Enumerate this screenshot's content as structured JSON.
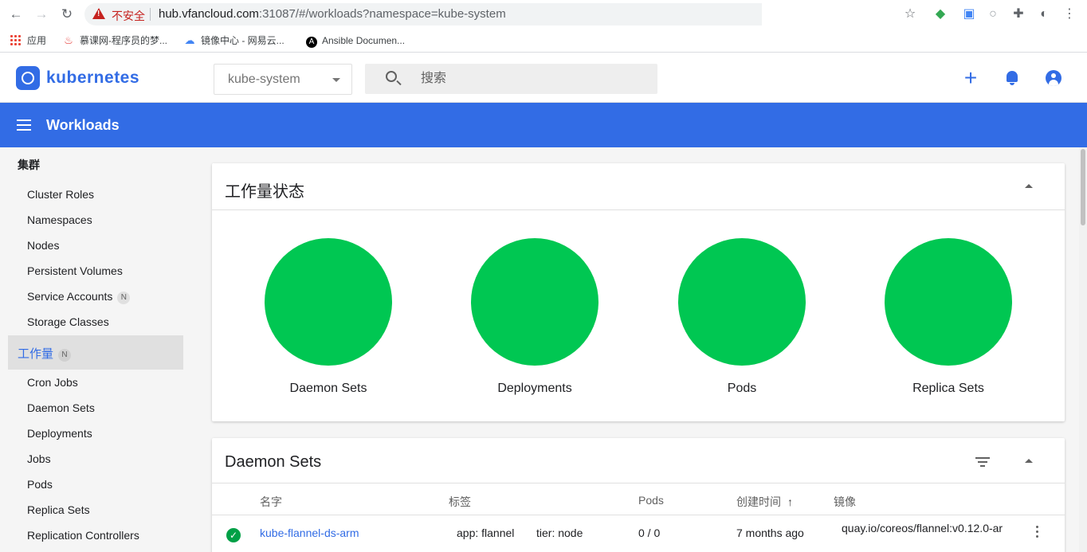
{
  "browser": {
    "security_label": "不安全",
    "url_host": "hub.vfancloud.com",
    "url_rest": ":31087/#/workloads?namespace=kube-system"
  },
  "bookmarks": [
    {
      "label": "应用"
    },
    {
      "label": "慕课网-程序员的梦..."
    },
    {
      "label": "镜像中心 - 网易云..."
    },
    {
      "label": "Ansible Documen..."
    }
  ],
  "header": {
    "brand": "kubernetes",
    "namespace": "kube-system",
    "search_placeholder": "搜索"
  },
  "toolbar": {
    "title": "Workloads"
  },
  "sidebar": {
    "cluster_header": "集群",
    "cluster_items": [
      {
        "label": "Cluster Roles"
      },
      {
        "label": "Namespaces"
      },
      {
        "label": "Nodes"
      },
      {
        "label": "Persistent Volumes"
      },
      {
        "label": "Service Accounts",
        "badge": "N"
      },
      {
        "label": "Storage Classes"
      }
    ],
    "active": {
      "label": "工作量",
      "badge": "N"
    },
    "workload_items": [
      {
        "label": "Cron Jobs"
      },
      {
        "label": "Daemon Sets"
      },
      {
        "label": "Deployments"
      },
      {
        "label": "Jobs"
      },
      {
        "label": "Pods"
      },
      {
        "label": "Replica Sets"
      },
      {
        "label": "Replication Controllers"
      }
    ]
  },
  "status_card": {
    "title": "工作量状态",
    "items": [
      {
        "label": "Daemon Sets"
      },
      {
        "label": "Deployments"
      },
      {
        "label": "Pods"
      },
      {
        "label": "Replica Sets"
      }
    ],
    "ok_color": "#00c752"
  },
  "daemon_sets": {
    "title": "Daemon Sets",
    "columns": {
      "name": "名字",
      "labels": "标签",
      "pods": "Pods",
      "created": "创建时间",
      "images": "镜像"
    },
    "rows": [
      {
        "name": "kube-flannel-ds-arm",
        "label1": "app: flannel",
        "label2": "tier: node",
        "pods": "0 / 0",
        "created": "7 months ago",
        "image": "quay.io/coreos/flannel:v0.12.0-ar"
      }
    ]
  },
  "colors": {
    "accent": "#326ce5",
    "status_ok": "#00c752"
  }
}
